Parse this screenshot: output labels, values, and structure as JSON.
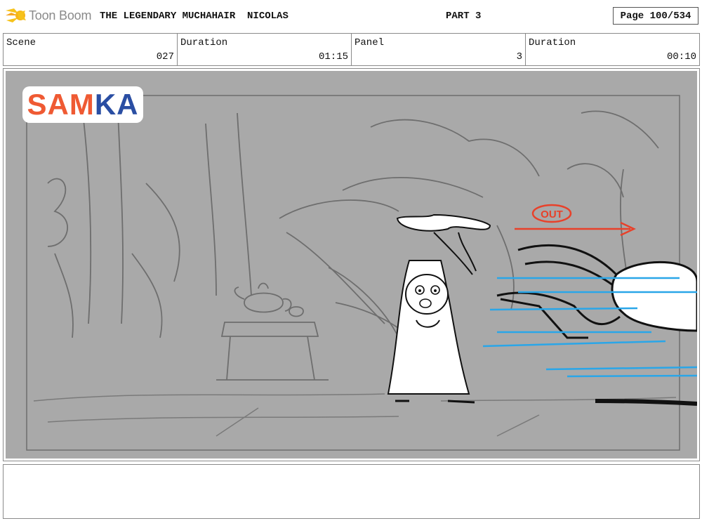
{
  "header": {
    "logo_text": "Toon Boom",
    "title": "THE LEGENDARY MUCHAHAIR  NICOLAS",
    "part": "PART 3",
    "page": "Page 100/534"
  },
  "info": {
    "scene_label": "Scene",
    "scene_value": "027",
    "scene_duration_label": "Duration",
    "scene_duration_value": "01:15",
    "panel_label": "Panel",
    "panel_value": "3",
    "panel_duration_label": "Duration",
    "panel_duration_value": "00:10"
  },
  "panel": {
    "brand_part1": "SAM",
    "brand_part2": "KA",
    "annotation": "OUT",
    "colors": {
      "background": "#a9a9a9",
      "sketch": "#6e6e6e",
      "annotation_red": "#e8412a",
      "speed_lines": "#2aa6e8",
      "brand_orange": "#ef5a33",
      "brand_blue": "#2a4ea3"
    }
  },
  "notes": {
    "text": ""
  }
}
